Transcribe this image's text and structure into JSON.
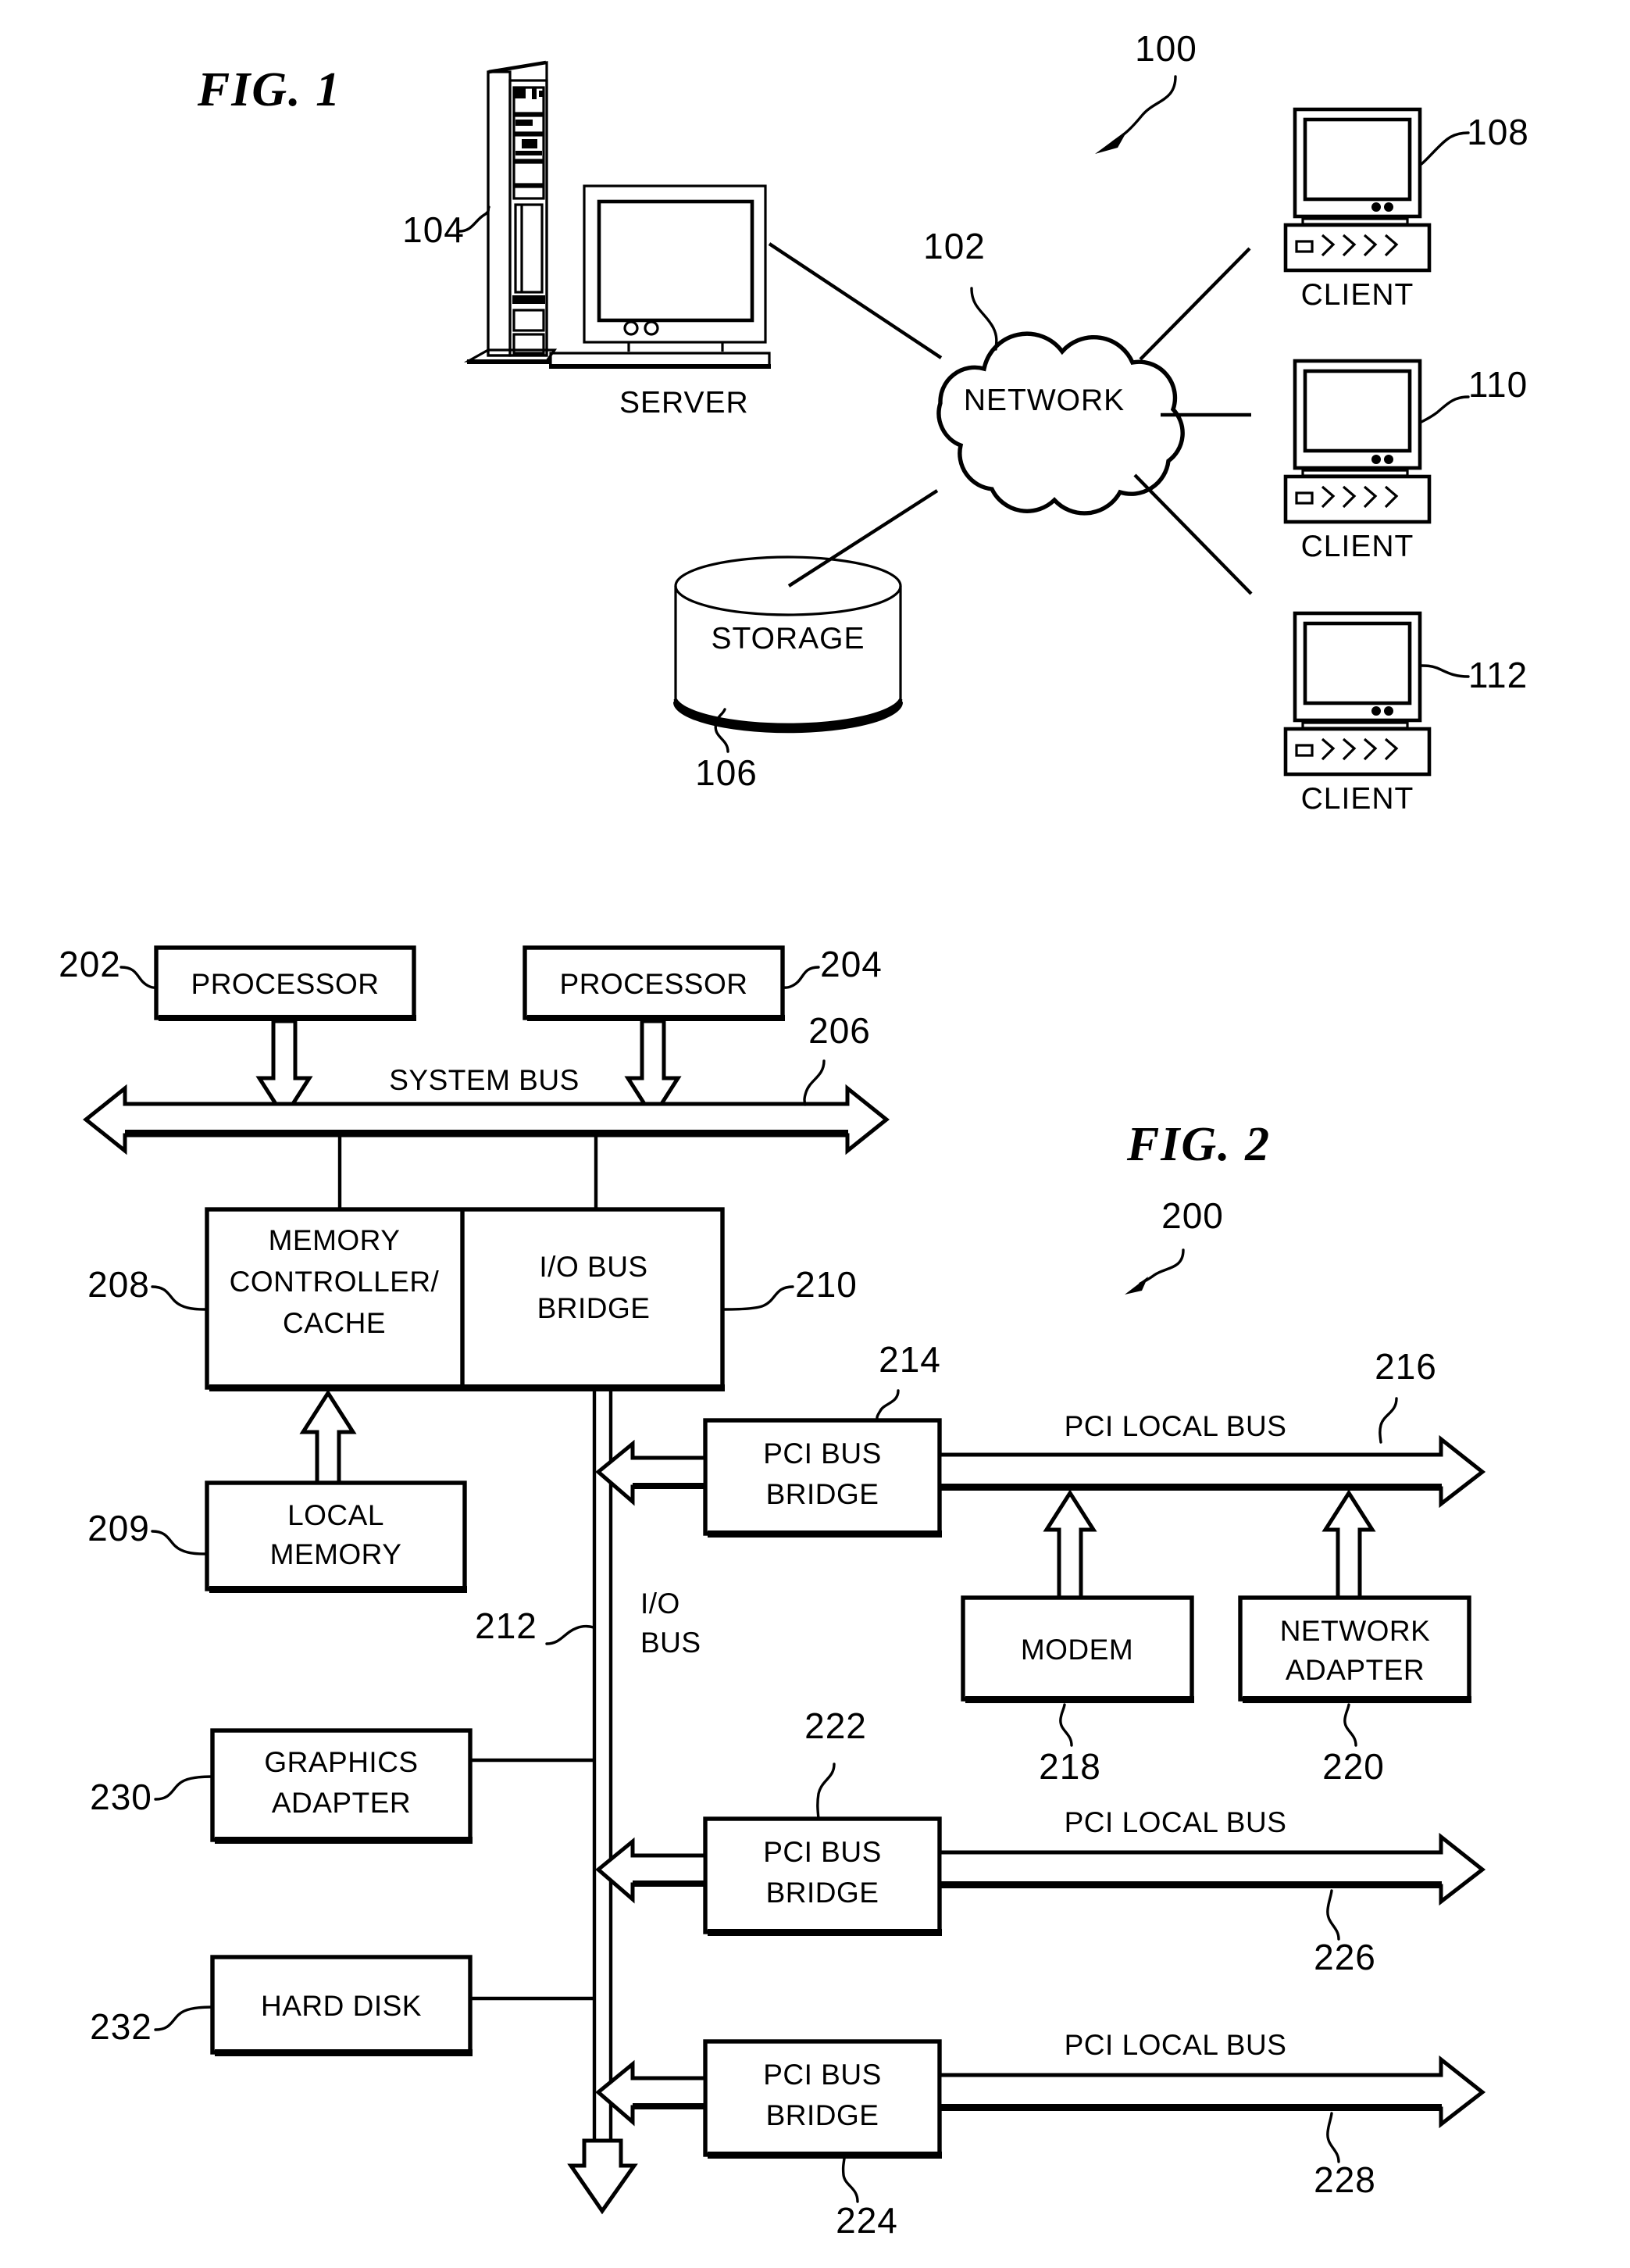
{
  "figure1": {
    "title": "FIG. 1",
    "system_ref": "100",
    "nodes": [
      {
        "name": "server",
        "label": "SERVER",
        "ref": "104"
      },
      {
        "name": "network",
        "label": "NETWORK",
        "ref": "102"
      },
      {
        "name": "storage",
        "label": "STORAGE",
        "ref": "106"
      },
      {
        "name": "client1",
        "label": "CLIENT",
        "ref": "108"
      },
      {
        "name": "client2",
        "label": "CLIENT",
        "ref": "110"
      },
      {
        "name": "client3",
        "label": "CLIENT",
        "ref": "112"
      }
    ]
  },
  "figure2": {
    "title": "FIG. 2",
    "system_ref": "200",
    "blocks": [
      {
        "name": "processor-1",
        "label": "PROCESSOR",
        "ref": "202"
      },
      {
        "name": "processor-2",
        "label": "PROCESSOR",
        "ref": "204"
      },
      {
        "name": "memory-controller",
        "label": "MEMORY CONTROLLER/ CACHE",
        "ref": "208"
      },
      {
        "name": "io-bus-bridge",
        "label": "I/O BUS BRIDGE",
        "ref": "210"
      },
      {
        "name": "local-memory",
        "label": "LOCAL MEMORY",
        "ref": "209"
      },
      {
        "name": "pci-bus-bridge-1",
        "label": "PCI BUS BRIDGE",
        "ref": "214"
      },
      {
        "name": "modem",
        "label": "MODEM",
        "ref": "218"
      },
      {
        "name": "network-adapter",
        "label": "NETWORK ADAPTER",
        "ref": "220"
      },
      {
        "name": "graphics-adapter",
        "label": "GRAPHICS ADAPTER",
        "ref": "230"
      },
      {
        "name": "hard-disk",
        "label": "HARD DISK",
        "ref": "232"
      },
      {
        "name": "pci-bus-bridge-2",
        "label": "PCI BUS BRIDGE",
        "ref": "222"
      },
      {
        "name": "pci-bus-bridge-3",
        "label": "PCI BUS BRIDGE",
        "ref": "224"
      }
    ],
    "buses": [
      {
        "name": "system-bus",
        "label": "SYSTEM BUS",
        "ref": "206"
      },
      {
        "name": "io-bus",
        "label": "I/O BUS",
        "ref": "212"
      },
      {
        "name": "pci-local-bus-1",
        "label": "PCI LOCAL BUS",
        "ref": "216"
      },
      {
        "name": "pci-local-bus-2",
        "label": "PCI LOCAL BUS",
        "ref": "226"
      },
      {
        "name": "pci-local-bus-3",
        "label": "PCI LOCAL BUS",
        "ref": "228"
      }
    ],
    "text": {
      "memory_controller_l1": "MEMORY",
      "memory_controller_l2": "CONTROLLER/",
      "memory_controller_l3": "CACHE",
      "io_bus_bridge_l1": "I/O BUS",
      "io_bus_bridge_l2": "BRIDGE",
      "local_memory_l1": "LOCAL",
      "local_memory_l2": "MEMORY",
      "pci_bridge_l1": "PCI BUS",
      "pci_bridge_l2": "BRIDGE",
      "network_adapter_l1": "NETWORK",
      "network_adapter_l2": "ADAPTER",
      "graphics_adapter_l1": "GRAPHICS",
      "graphics_adapter_l2": "ADAPTER",
      "io_bus_l1": "I/O",
      "io_bus_l2": "BUS"
    }
  }
}
